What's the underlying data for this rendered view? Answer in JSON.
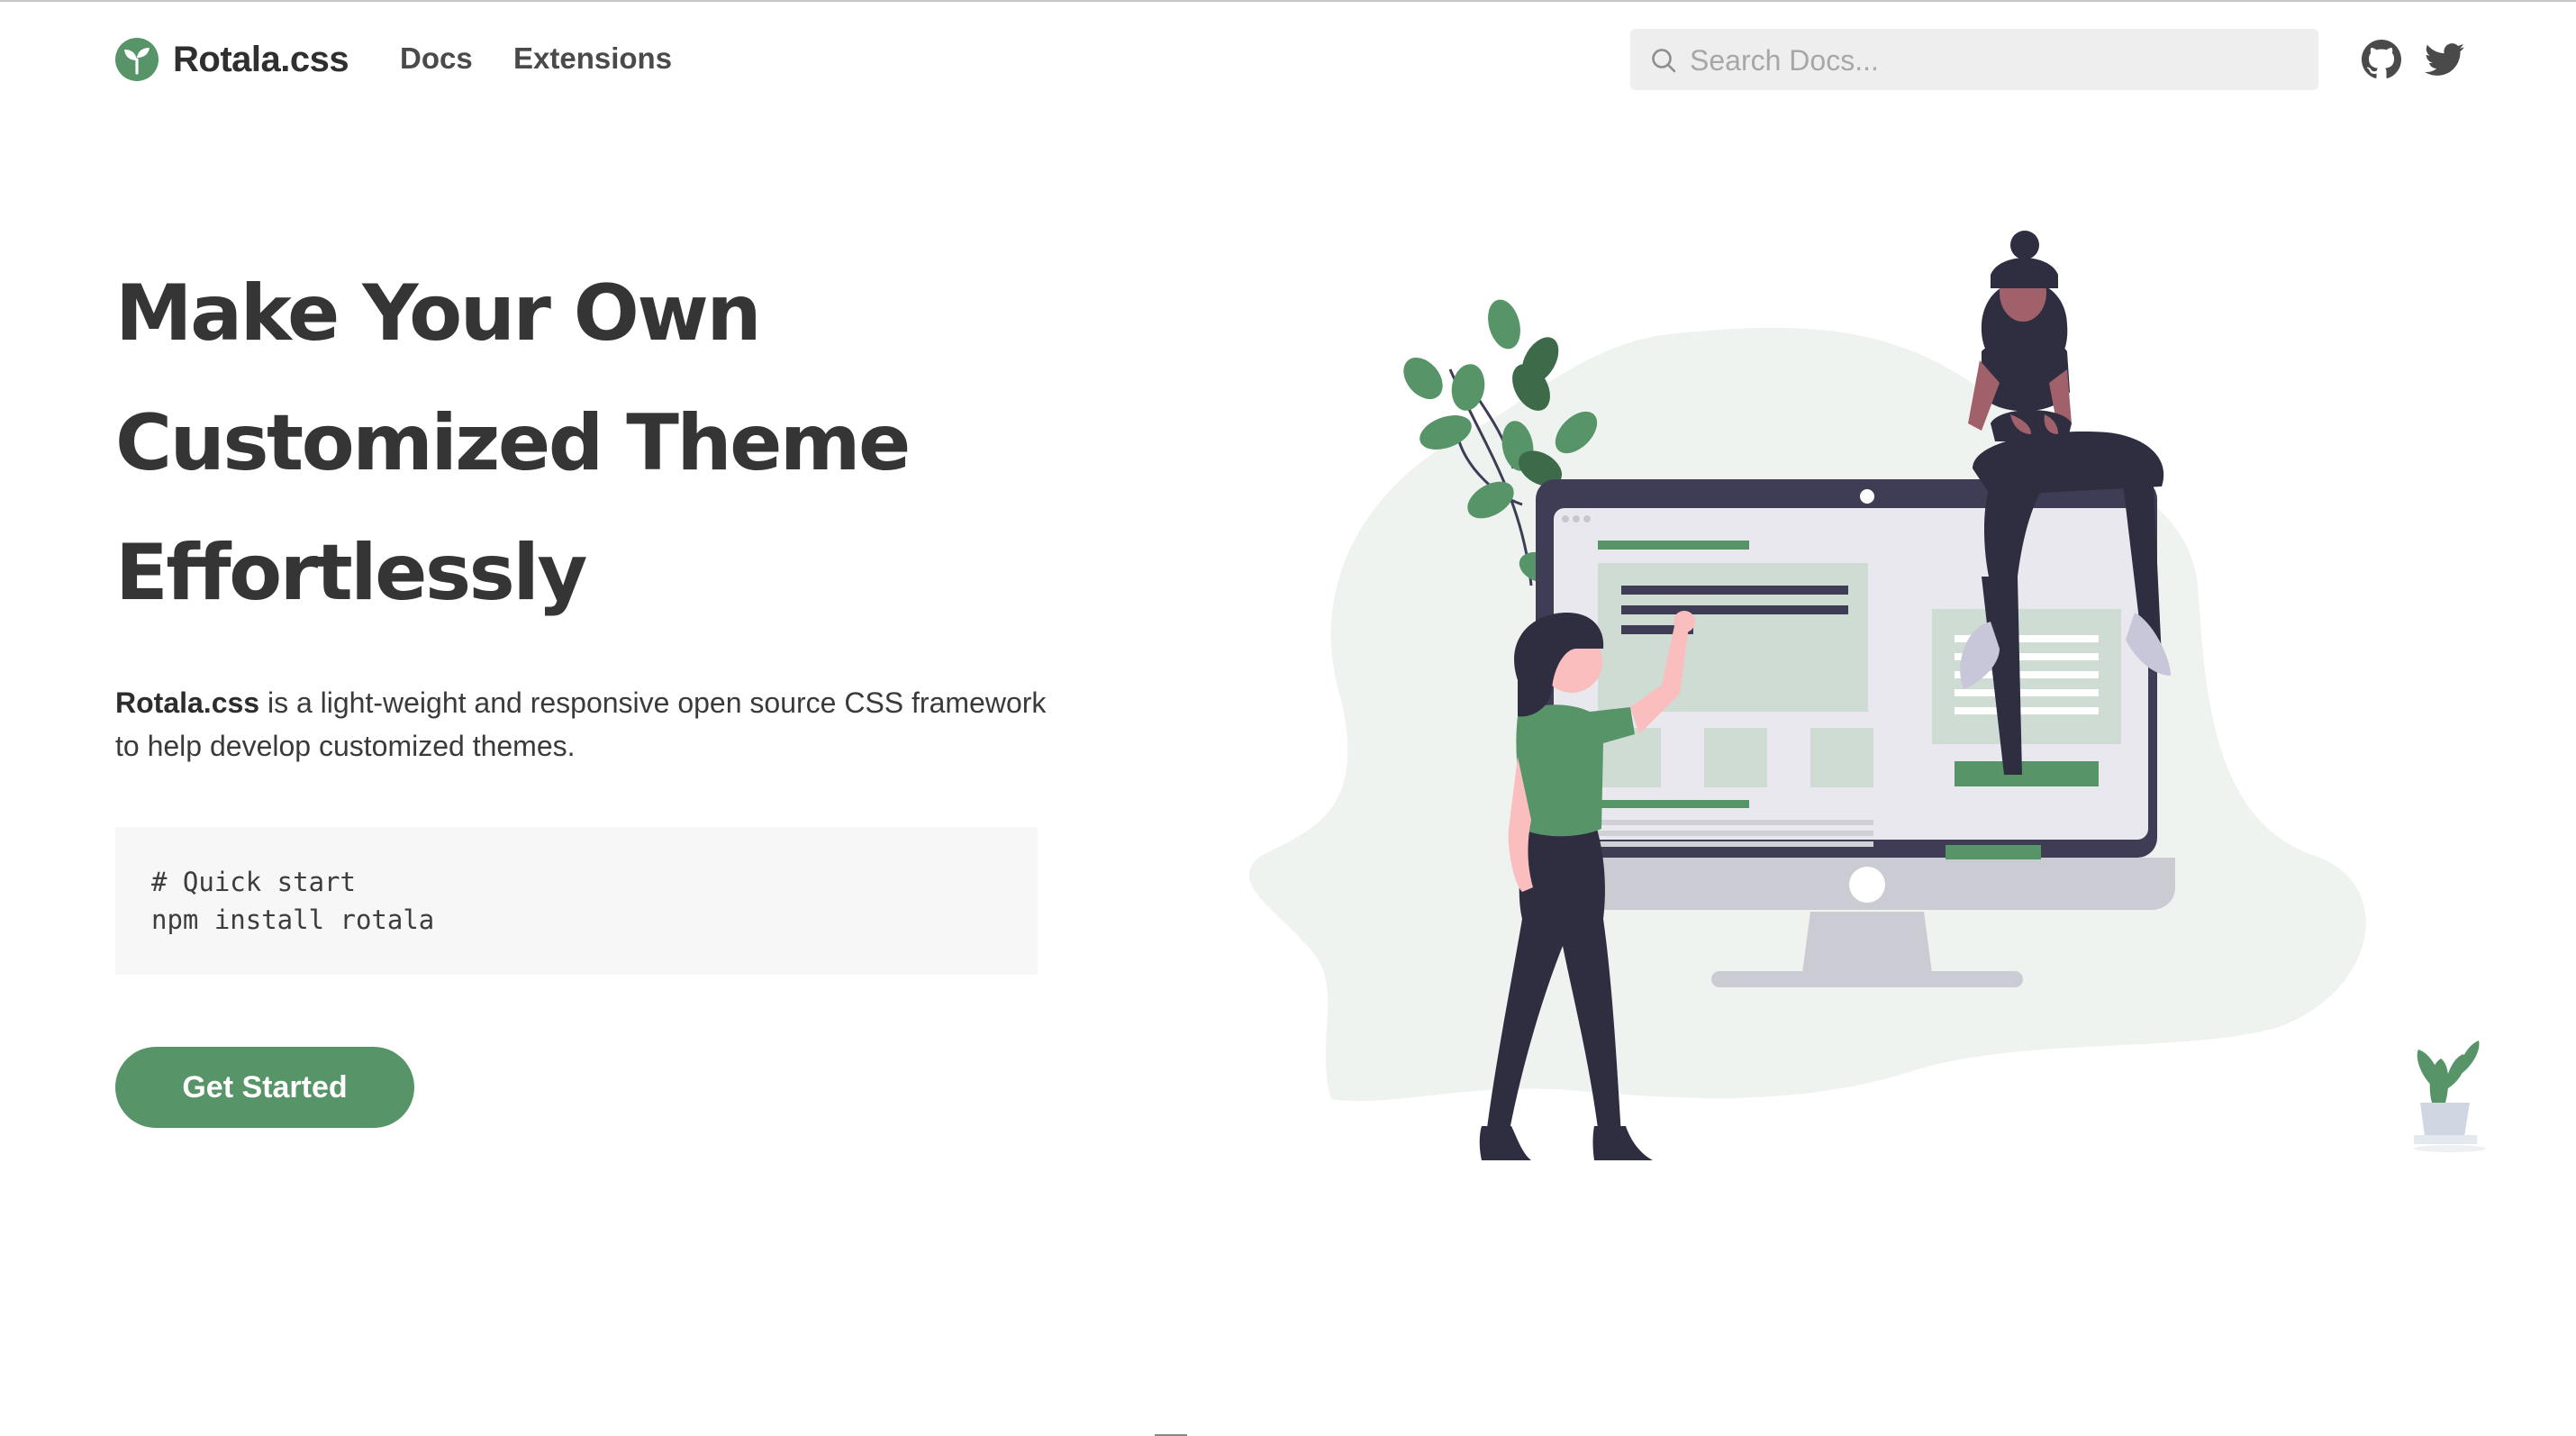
{
  "brand": {
    "name": "Rotala.css",
    "logo_icon": "sprout-logo-icon",
    "accent_color": "#579468"
  },
  "nav": {
    "links": [
      {
        "label": "Docs"
      },
      {
        "label": "Extensions"
      }
    ]
  },
  "search": {
    "placeholder": "Search Docs...",
    "value": "",
    "icon": "search-icon"
  },
  "social": [
    {
      "icon": "github-icon"
    },
    {
      "icon": "twitter-icon"
    }
  ],
  "hero": {
    "title_lines": [
      "Make Your Own",
      "Customized Theme",
      "Effortlessly"
    ],
    "description_strong": "Rotala.css",
    "description_rest": " is a light-weight and responsive open source CSS framework to help develop customized themes.",
    "code_lines": [
      "# Quick start",
      "npm install rotala"
    ],
    "cta_label": "Get Started"
  },
  "illustration": {
    "icon": "people-building-website-illustration",
    "colors": {
      "blob": "#eef3ef",
      "monitor": "#3f3d56",
      "screen": "#e9e8ee",
      "green": "#579468",
      "skin": "#a0616a"
    }
  }
}
